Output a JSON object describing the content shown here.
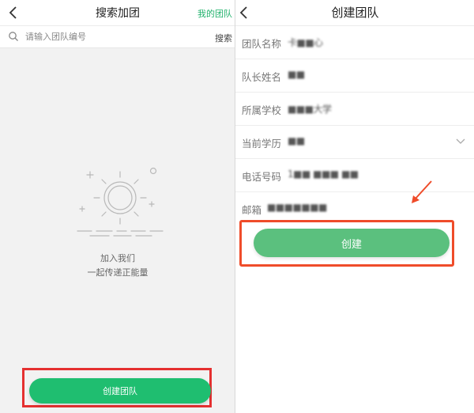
{
  "left_screen": {
    "title": "搜索加团",
    "right_link": "我的团队",
    "search": {
      "placeholder": "请输入团队编号",
      "button": "搜索"
    },
    "empty_state": {
      "line1": "加入我们",
      "line2": "一起传递正能量",
      "illustration": "sun-icon"
    },
    "create_team_button": "创建团队",
    "highlight_color": "#e53030"
  },
  "right_screen": {
    "title": "创建团队",
    "fields": [
      {
        "label": "团队名称",
        "value": "卡■■心"
      },
      {
        "label": "队长姓名",
        "value": "■■"
      },
      {
        "label": "所属学校",
        "value": "■■■大学"
      },
      {
        "label": "当前学历",
        "value": "■■",
        "has_dropdown": true
      },
      {
        "label": "电话号码",
        "value": "1■■ ■■■ ■■"
      },
      {
        "label": "邮箱",
        "value": "■■■■■■■"
      }
    ],
    "create_button": "创建",
    "highlight_color": "#ef4c2a",
    "accent_color": "#5bc07e"
  }
}
